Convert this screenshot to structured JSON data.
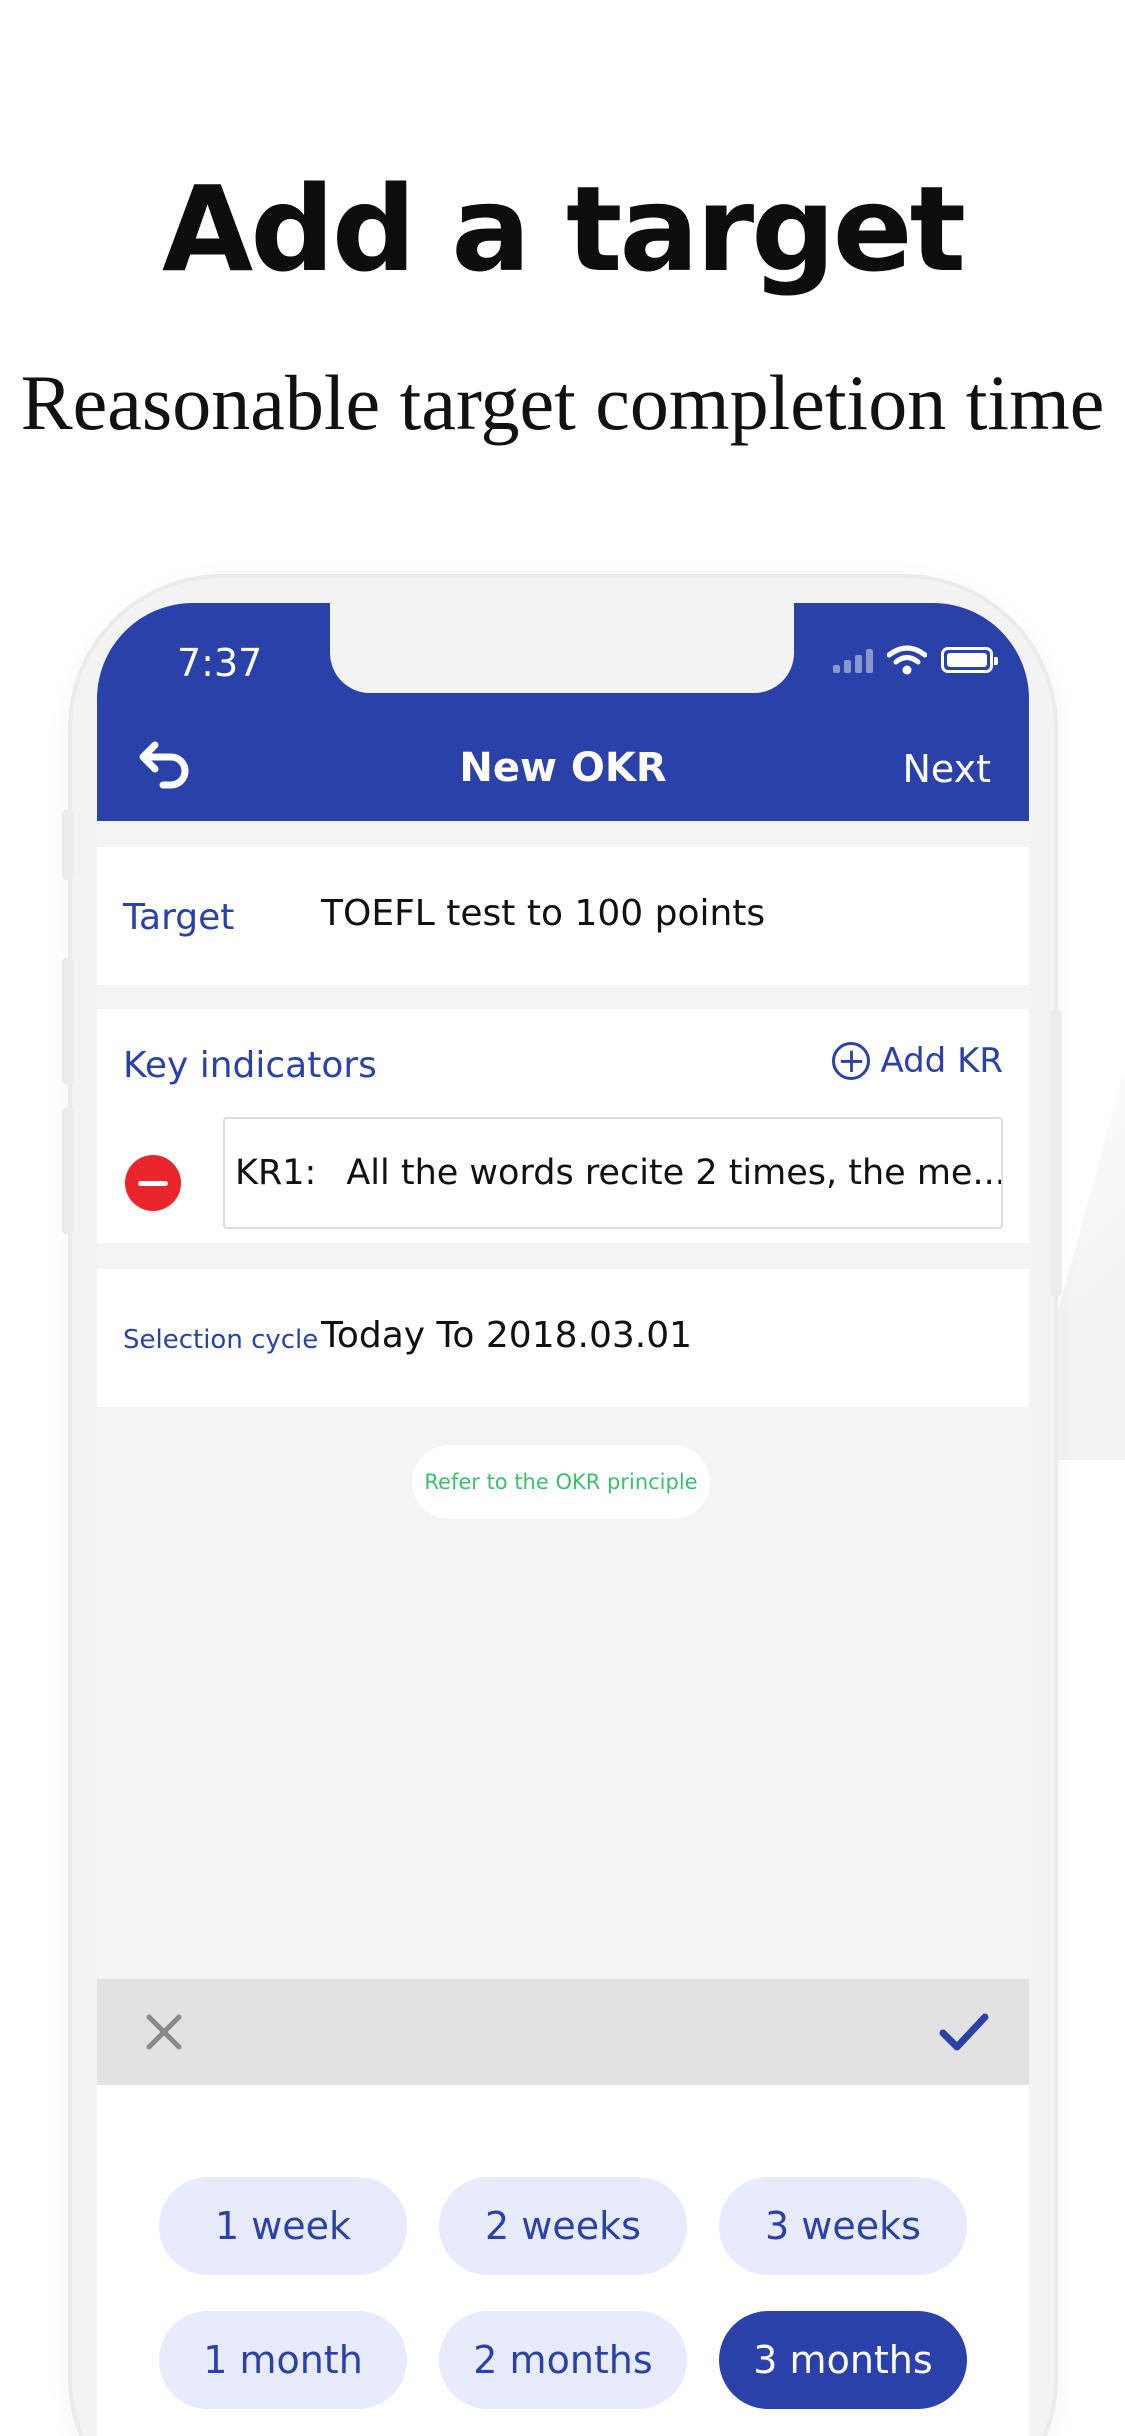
{
  "promo": {
    "headline": "Add a target",
    "subline": "Reasonable target completion time"
  },
  "status_bar": {
    "time": "7:37",
    "icons": [
      "cellular-signal-icon",
      "wifi-icon",
      "battery-icon"
    ]
  },
  "nav": {
    "back_icon": "back-arrow-icon",
    "title": "New OKR",
    "next_label": "Next"
  },
  "form": {
    "target_label": "Target",
    "target_value": "TOEFL test to 100 points",
    "key_indicators_label": "Key indicators",
    "add_kr_label": "Add KR",
    "key_results": [
      {
        "number": "KR1:",
        "text": "All the words recite 2 times, the me..."
      }
    ],
    "cycle_label": "Selection cycle",
    "cycle_value": "Today To 2018.03.01",
    "okr_principle_link": "Refer to the OKR principle"
  },
  "picker": {
    "cancel_icon": "close-icon",
    "confirm_icon": "checkmark-icon",
    "options": [
      {
        "label": "1 week",
        "selected": false
      },
      {
        "label": "2 weeks",
        "selected": false
      },
      {
        "label": "3 weeks",
        "selected": false
      },
      {
        "label": "1 month",
        "selected": false
      },
      {
        "label": "2 months",
        "selected": false
      },
      {
        "label": "3 months",
        "selected": true
      }
    ]
  },
  "colors": {
    "brand_blue": "#2b41aa",
    "chip_bg": "#e7ebfb",
    "remove_red": "#e8262c",
    "link_green": "#3cbf6c"
  }
}
